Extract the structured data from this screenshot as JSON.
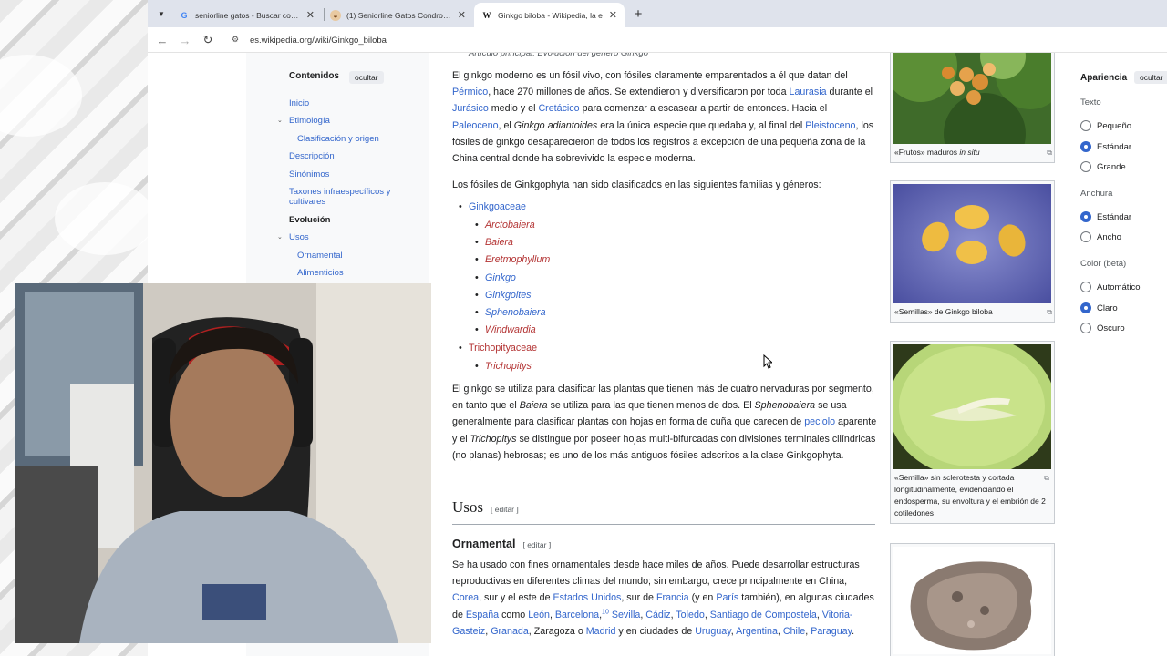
{
  "browser": {
    "tabs": [
      {
        "title": "seniorline gatos - Buscar con G",
        "icon": "google-icon"
      },
      {
        "title": "(1) Seniorline Gatos Condroprot",
        "icon": "cat-icon"
      },
      {
        "title": "Ginkgo biloba - Wikipedia, la e",
        "icon": "wikipedia-icon"
      }
    ],
    "url": "es.wikipedia.org/wiki/Ginkgo_biloba"
  },
  "toc": {
    "title": "Contenidos",
    "hide_label": "ocultar",
    "items": [
      {
        "label": "Inicio"
      },
      {
        "label": "Etimología"
      },
      {
        "label": "Clasificación y origen"
      },
      {
        "label": "Descripción"
      },
      {
        "label": "Sinónimos"
      },
      {
        "label": "Taxones infraespecíficos y"
      },
      {
        "label": "cultivares"
      },
      {
        "label": "Evolución"
      },
      {
        "label": "Usos"
      },
      {
        "label": "Ornamental"
      },
      {
        "label": "Alimenticios"
      }
    ]
  },
  "article": {
    "sub_note": "Artículo principal: Evolución del género Ginkgo",
    "p1": [
      {
        "t": "El ginkgo moderno es un fósil vivo, con fósiles claramente emparentados a él que datan del "
      },
      {
        "t": "Pérmico",
        "link": true
      },
      {
        "t": ", hace 270 millones de años. Se extendieron y diversificaron por toda "
      },
      {
        "t": "Laurasia",
        "link": true
      },
      {
        "t": " durante el "
      },
      {
        "t": "Jurásico",
        "link": true
      },
      {
        "t": " medio y el "
      },
      {
        "t": "Cretácico",
        "link": true
      },
      {
        "t": " para comenzar a escasear a partir de entonces. Hacia el "
      },
      {
        "t": "Paleoceno",
        "link": true
      },
      {
        "t": ", el "
      },
      {
        "t": "Ginkgo adiantoides",
        "italic": true
      },
      {
        "t": " era la única especie que quedaba y, al final del "
      },
      {
        "t": "Pleistoceno",
        "link": true
      },
      {
        "t": ", los fósiles de ginkgo desaparecieron de todos los registros a excepción de una pequeña zona de la China central donde ha sobrevivido la especie moderna."
      }
    ],
    "p2": "Los fósiles de Ginkgophyta han sido clasificados en las siguientes familias y géneros:",
    "families": [
      {
        "name": "Ginkgoaceae",
        "genera": [
          {
            "name": "Arctobaiera",
            "missing": true
          },
          {
            "name": "Baiera",
            "missing": true
          },
          {
            "name": "Eretmophyllum",
            "missing": true
          },
          {
            "name": "Ginkgo",
            "missing": false
          },
          {
            "name": "Ginkgoites",
            "missing": false
          },
          {
            "name": "Sphenobaiera",
            "missing": false
          },
          {
            "name": "Windwardia",
            "missing": true
          }
        ]
      },
      {
        "name": "Trichopityaceae",
        "missing": true,
        "genera": [
          {
            "name": "Trichopitys",
            "missing": true
          }
        ]
      }
    ],
    "p3": [
      {
        "t": "El ginkgo se utiliza para clasificar las plantas que tienen más de cuatro nervaduras por segmento, en tanto que el "
      },
      {
        "t": "Baiera",
        "italic": true
      },
      {
        "t": " se utiliza para las que tienen menos de dos. El "
      },
      {
        "t": "Sphenobaiera",
        "italic": true
      },
      {
        "t": " se usa generalmente para clasificar plantas con hojas en forma de cuña que carecen de "
      },
      {
        "t": "peciolo",
        "link": true
      },
      {
        "t": " aparente y el "
      },
      {
        "t": "Trichopitys",
        "italic": true
      },
      {
        "t": " se distingue por poseer hojas multi-bifurcadas con divisiones terminales cilíndricas (no planas) hebrosas; es uno de los más antiguos fósiles adscritos a la clase Ginkgophyta."
      }
    ],
    "h_usos": "Usos",
    "h_ornamental": "Ornamental",
    "edit_label": "[ editar ]",
    "p4": [
      {
        "t": "Se ha usado con fines ornamentales desde hace miles de años. Puede desarrollar estructuras reproductivas en diferentes climas del mundo; sin embargo, crece principalmente en China, "
      },
      {
        "t": "Corea",
        "link": true
      },
      {
        "t": ", sur y el este de "
      },
      {
        "t": "Estados Unidos",
        "link": true
      },
      {
        "t": ", sur de "
      },
      {
        "t": "Francia",
        "link": true
      },
      {
        "t": " (y en "
      },
      {
        "t": "París",
        "link": true
      },
      {
        "t": " también), en algunas ciudades de "
      },
      {
        "t": "España",
        "link": true
      },
      {
        "t": " como "
      },
      {
        "t": "León",
        "link": true
      },
      {
        "t": ", "
      },
      {
        "t": "Barcelona",
        "link": true
      },
      {
        "t": ",",
        "sup_after": "10"
      },
      {
        "t": " "
      },
      {
        "t": "Sevilla",
        "link": true
      },
      {
        "t": ", "
      },
      {
        "t": "Cádiz",
        "link": true
      },
      {
        "t": ", "
      },
      {
        "t": "Toledo",
        "link": true
      },
      {
        "t": ", "
      },
      {
        "t": "Santiago de Compostela",
        "link": true
      },
      {
        "t": ", "
      },
      {
        "t": "Vitoria-Gasteiz",
        "link": true
      },
      {
        "t": ", "
      },
      {
        "t": "Granada",
        "link": true
      },
      {
        "t": ", Zaragoza o "
      },
      {
        "t": "Madrid",
        "link": true
      },
      {
        "t": " y en ciudades de "
      },
      {
        "t": "Uruguay",
        "link": true
      },
      {
        "t": ", "
      },
      {
        "t": "Argentina",
        "link": true
      },
      {
        "t": ", "
      },
      {
        "t": "Chile",
        "link": true
      },
      {
        "t": ", "
      },
      {
        "t": "Paraguay",
        "link": true
      },
      {
        "t": "."
      }
    ]
  },
  "images": [
    {
      "caption": [
        {
          "t": "«Frutos» maduros "
        },
        {
          "t": "in situ",
          "italic": true
        }
      ]
    },
    {
      "caption": [
        {
          "t": "«Semillas» de Ginkgo biloba"
        }
      ]
    },
    {
      "caption": [
        {
          "t": "«Semilla» sin sclerotesta y cortada longitudinalmente, evidenciando el endosperma, su envoltura y el embrión de 2 cotiledones"
        }
      ]
    }
  ],
  "appearance": {
    "title": "Apariencia",
    "hide_label": "ocultar",
    "text_label": "Texto",
    "text_options": [
      {
        "label": "Pequeño",
        "checked": false
      },
      {
        "label": "Estándar",
        "checked": true
      },
      {
        "label": "Grande",
        "checked": false
      }
    ],
    "width_label": "Anchura",
    "width_options": [
      {
        "label": "Estándar",
        "checked": true
      },
      {
        "label": "Ancho",
        "checked": false
      }
    ],
    "color_label": "Color (beta)",
    "color_options": [
      {
        "label": "Automático",
        "checked": false
      },
      {
        "label": "Claro",
        "checked": true
      },
      {
        "label": "Oscuro",
        "checked": false
      }
    ]
  },
  "colors": {
    "link": "#3366cc",
    "missing_link": "#b33333",
    "tab_strip": "#dfe3ec",
    "radio_on": "#3366cc"
  }
}
